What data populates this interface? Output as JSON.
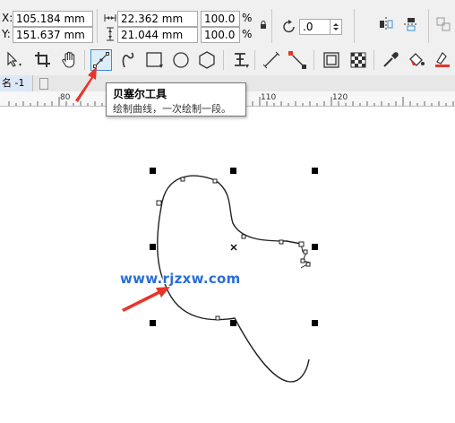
{
  "property_bar": {
    "x_label": "X:",
    "x_value": "105.184 mm",
    "y_label": "Y:",
    "y_value": "151.637 mm",
    "width_value": "22.362 mm",
    "height_value": "21.044 mm",
    "scale_x": "100.0",
    "scale_y": "100.0",
    "percent_symbol": "%",
    "rotation_value": ".0"
  },
  "doc_tab": {
    "label": "名 -1"
  },
  "ruler": {
    "ticks": [
      "80",
      "110",
      "120"
    ]
  },
  "tooltip": {
    "title": "贝塞尔工具",
    "description": "绘制曲线，一次绘制一段。"
  },
  "watermark": {
    "text": "www.rjzxw.com"
  },
  "colors": {
    "accent": "#3b8fd6",
    "arrow": "#e8352b",
    "watermark": "#2a6fd6"
  }
}
